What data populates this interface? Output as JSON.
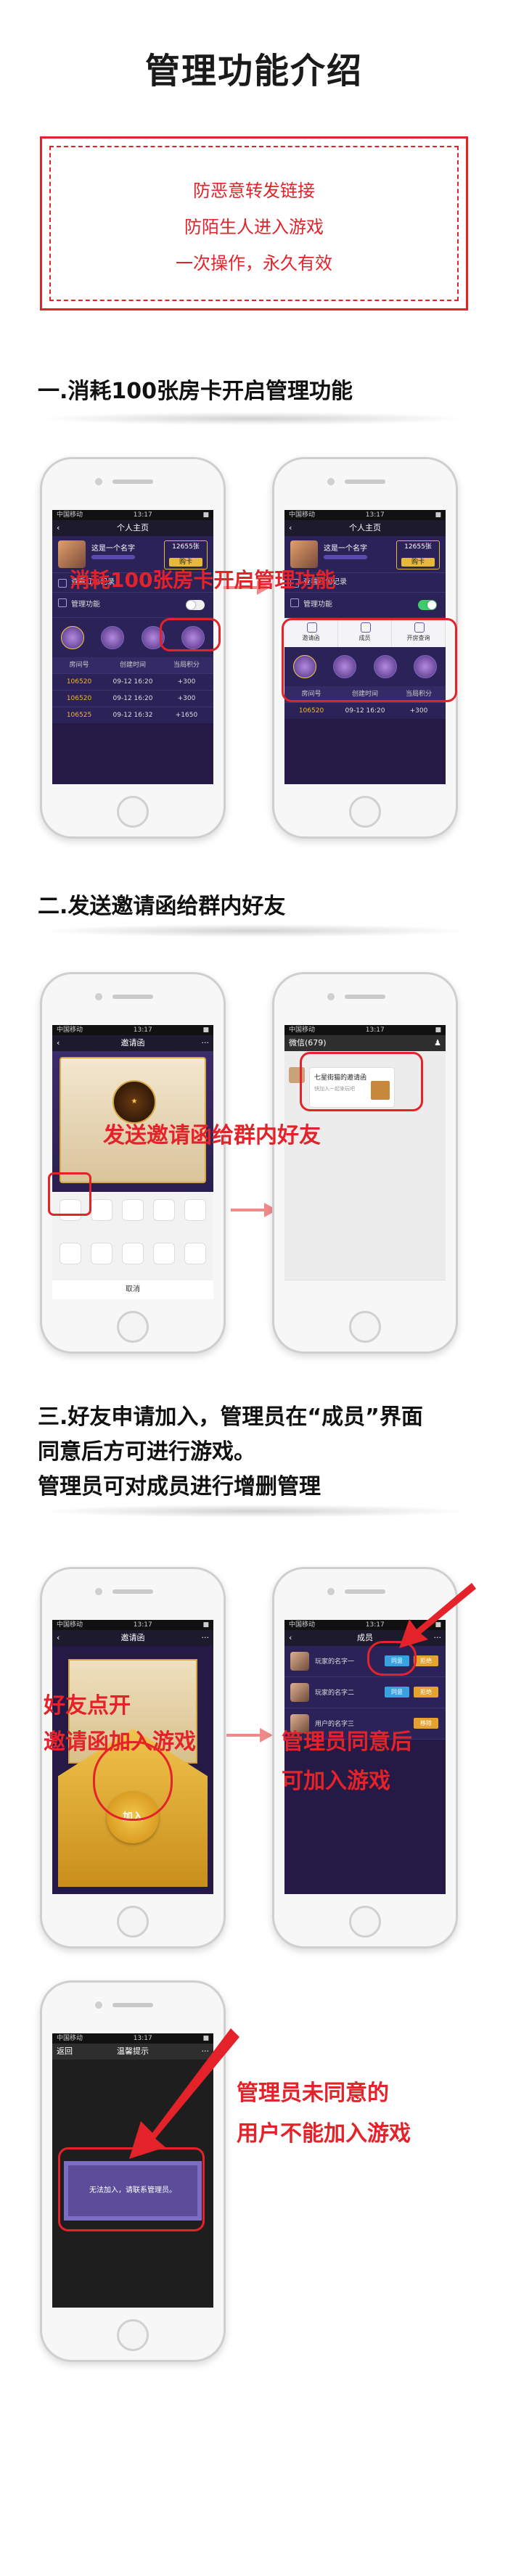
{
  "page_title": "管理功能介绍",
  "notice": {
    "lines": [
      "防恶意转发链接",
      "防陌生人进入游戏",
      "一次操作，永久有效"
    ]
  },
  "sections": {
    "s1": "一.消耗100张房卡开启管理功能",
    "s2": "二.发送邀请函给群内好友",
    "s3_line1": "三.好友申请加入，管理员在“成员”界面",
    "s3_line2": "同意后方可进行游戏。",
    "s3_line3": "管理员可对成员进行增删管理"
  },
  "overlays": {
    "o1": "消耗100张房卡开启管理功能",
    "o2": "发送邀请函给群内好友",
    "o3_left_1": "好友点开",
    "o3_left_2": "邀请函加入游戏",
    "o3_right_1": "管理员同意后",
    "o3_right_2": "可加入游戏",
    "o4_1": "管理员未同意的",
    "o4_2": "用户不能加入游戏"
  },
  "phone_status": {
    "carrier": "中国移动",
    "time": "13:17"
  },
  "profile_screen": {
    "nav_title": "个人主页",
    "name": "这是一个名字",
    "card_count": "12655张",
    "buy": "购卡",
    "row_red_packet": "查看红包记录",
    "row_mgmt": "管理功能",
    "mgmt_items": [
      "邀请函",
      "成员",
      "开房查询"
    ],
    "table_headers": [
      "房间号",
      "创建时间",
      "当局积分"
    ],
    "table_rows": [
      [
        "106520",
        "09-12 16:20",
        "+300"
      ],
      [
        "106520",
        "09-12 16:20",
        "+300"
      ],
      [
        "106525",
        "09-12 16:32",
        "+1650"
      ]
    ],
    "table_rows_b": [
      [
        "106520",
        "09-12 16:20",
        "+300"
      ]
    ]
  },
  "invite_screen": {
    "nav_title": "邀请函",
    "cancel": "取消",
    "chat_nav": "微信(679)",
    "chat_msg_title": "七星街猫的邀请函",
    "chat_msg_sub": "快加入一起来玩吧"
  },
  "join_screen": {
    "nav_title": "邀请函",
    "join": "加入"
  },
  "members_screen": {
    "nav_title": "成员",
    "members": [
      {
        "name": "玩家的名字一",
        "b1": "同意",
        "b2": "拒绝"
      },
      {
        "name": "玩家的名字二",
        "b1": "同意",
        "b2": "拒绝"
      },
      {
        "name": "用户的名字三",
        "b1": "",
        "b2": "移除"
      }
    ]
  },
  "warn_screen": {
    "nav_back": "返回",
    "nav_title": "温馨提示",
    "message": "无法加入，请联系管理员。"
  },
  "colors": {
    "accent_red": "#e4222a",
    "toggle_on": "#3fcb6a",
    "gold": "#e6b93e"
  },
  "icons": [
    "arrow-right-icon",
    "toggle-icon",
    "invite-icon",
    "members-icon",
    "room-query-icon"
  ]
}
